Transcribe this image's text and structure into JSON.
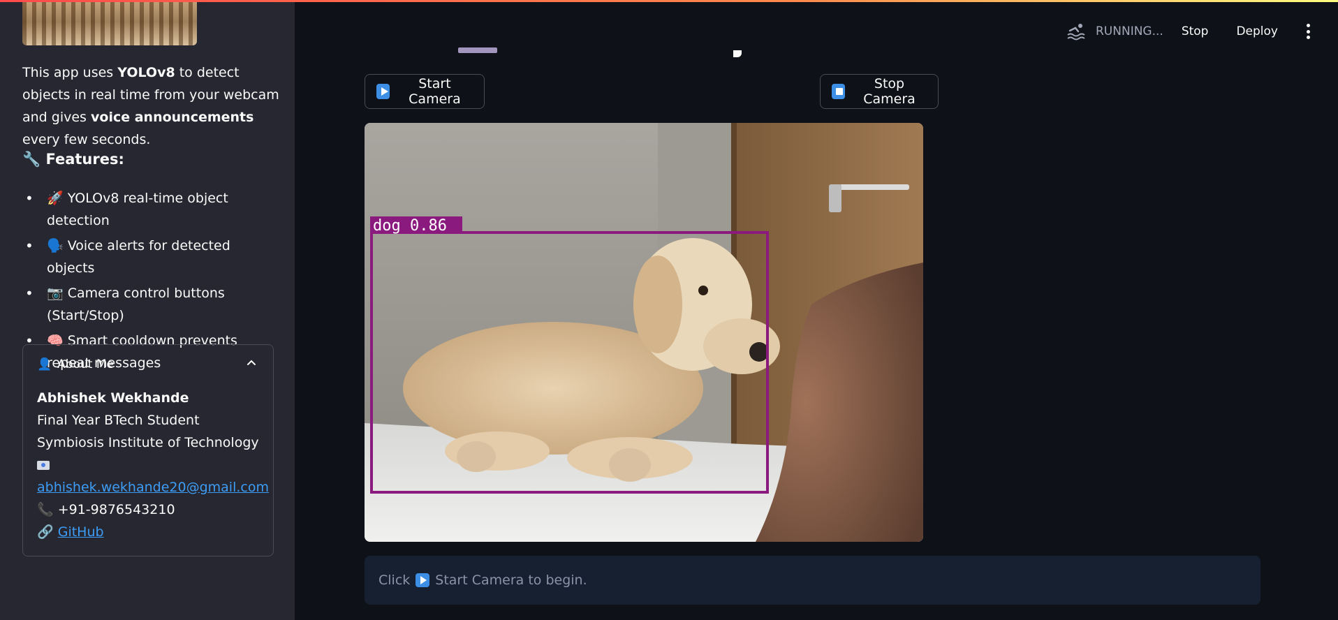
{
  "sidebar": {
    "intro_prefix": "This app uses ",
    "intro_model": "YOLOv8",
    "intro_mid": " to detect objects in real time from your webcam and gives ",
    "intro_bold": "voice announcements",
    "intro_suffix": " every few seconds.",
    "features_title": "🔧 Features:",
    "features": [
      "🚀 YOLOv8 real-time object detection",
      "🗣️ Voice alerts for detected objects",
      "📷 Camera control buttons (Start/Stop)",
      "🧠 Smart cooldown prevents repeat messages"
    ],
    "about": {
      "title": "About Me",
      "icon": "person-icon",
      "name": "Abhishek Wekhande",
      "line1": "Final Year BTech Student",
      "line2": "Symbiosis Institute of Technology",
      "email": "abhishek.wekhande20@gmail.com",
      "phone": "📞 +91-9876543210",
      "link_prefix": "🔗",
      "github": "GitHub"
    }
  },
  "header": {
    "status": "RUNNING...",
    "stop_label": "Stop",
    "deploy_label": "Deploy"
  },
  "controls": {
    "start_label": "Start Camera",
    "stop_label": "Stop Camera"
  },
  "camera": {
    "detection_label": "dog 0.86",
    "box_color": "#8b1a7f"
  },
  "info": {
    "prefix": "Click",
    "suffix": "Start Camera to begin."
  },
  "colors": {
    "background": "#0e1117",
    "sidebar": "#262730",
    "link": "#3d9df6",
    "info_bg": "#172030"
  }
}
